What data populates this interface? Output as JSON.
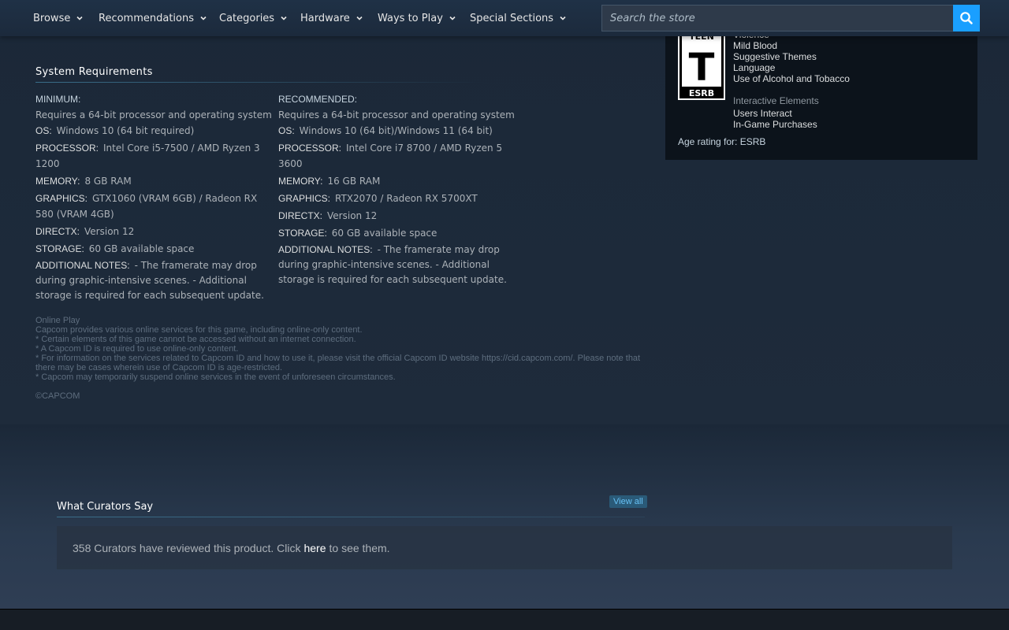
{
  "nav": {
    "items": [
      "Browse",
      "Recommendations",
      "Categories",
      "Hardware",
      "Ways to Play",
      "Special Sections"
    ],
    "search_placeholder": "Search the store"
  },
  "rating": {
    "esrb_top": "TEEN",
    "esrb_letter": "T",
    "esrb_brand": "ESRB",
    "descriptors": [
      "Violence",
      "Mild Blood",
      "Suggestive Themes",
      "Language",
      "Use of Alcohol and Tobacco"
    ],
    "interactive_label": "Interactive Elements",
    "interactive": [
      "Users Interact",
      "In-Game Purchases"
    ],
    "age_rating": "Age rating for: ESRB"
  },
  "sysreq": {
    "title": "System Requirements",
    "minimum": {
      "header": "MINIMUM:",
      "intro": "Requires a 64-bit processor and operating system",
      "os_k": "OS:",
      "os_v": "Windows 10 (64 bit required)",
      "cpu_k": "PROCESSOR:",
      "cpu_v": "Intel Core i5-7500 / AMD Ryzen 3 1200",
      "mem_k": "MEMORY:",
      "mem_v": "8 GB RAM",
      "gpu_k": "GRAPHICS:",
      "gpu_v": "GTX1060 (VRAM 6GB) / Radeon RX 580 (VRAM 4GB)",
      "dx_k": "DIRECTX:",
      "dx_v": "Version 12",
      "sto_k": "STORAGE:",
      "sto_v": "60 GB available space",
      "notes_k": "ADDITIONAL NOTES:",
      "notes_v": "- The framerate may drop during graphic-intensive scenes. - Additional storage is required for each subsequent update."
    },
    "recommended": {
      "header": "RECOMMENDED:",
      "intro": "Requires a 64-bit processor and operating system",
      "os_k": "OS:",
      "os_v": "Windows 10 (64 bit)/Windows 11 (64 bit)",
      "cpu_k": "PROCESSOR:",
      "cpu_v": "Intel Core i7 8700 / AMD Ryzen 5 3600",
      "mem_k": "MEMORY:",
      "mem_v": "16 GB RAM",
      "gpu_k": "GRAPHICS:",
      "gpu_v": "RTX2070 / Radeon RX 5700XT",
      "dx_k": "DIRECTX:",
      "dx_v": "Version 12",
      "sto_k": "STORAGE:",
      "sto_v": "60 GB available space",
      "notes_k": "ADDITIONAL NOTES:",
      "notes_v": "- The framerate may drop during graphic-intensive scenes. - Additional storage is required for each subsequent update."
    }
  },
  "legal": {
    "lines": [
      "Online Play",
      "Capcom provides various online services for this game, including online-only content.",
      "* Certain elements of this game cannot be accessed without an internet connection.",
      "* A Capcom ID is required to use online-only content.",
      "* For information on the services related to Capcom ID and how to use it, please visit the official Capcom ID website https://cid.capcom.com/. Please note that there may be cases wherein use of Capcom ID is age-restricted.",
      "* Capcom may temporarily suspend online services in the event of unforeseen circumstances."
    ],
    "copyright": "©CAPCOM"
  },
  "curators": {
    "title": "What Curators Say",
    "view_all": "View all",
    "text_before": "358 Curators have reviewed this product. Click",
    "link": "here",
    "text_after": "to see them."
  }
}
